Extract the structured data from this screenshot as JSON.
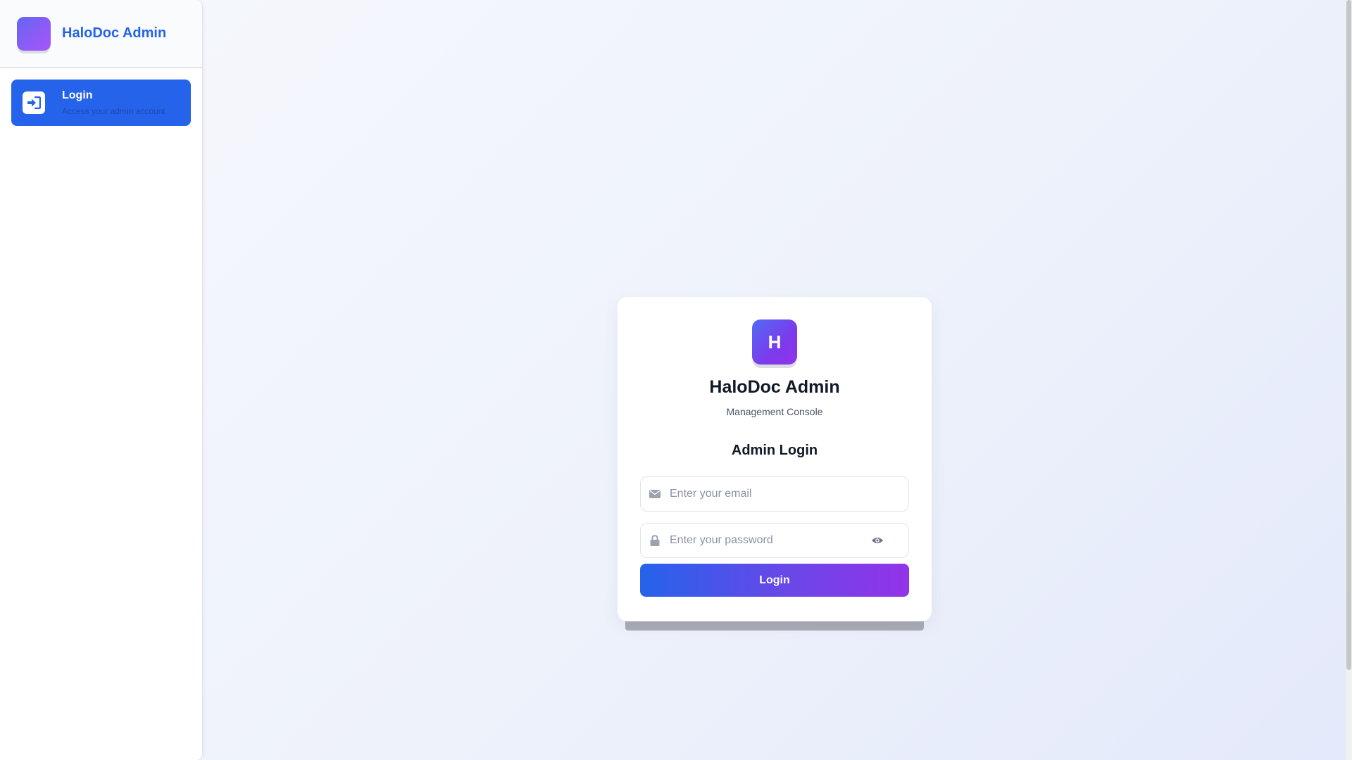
{
  "sidebar": {
    "brand_title": "HaloDoc Admin",
    "items": [
      {
        "label": "Login",
        "subtitle": "Access your admin account",
        "icon": "sign-in-icon",
        "active": true
      }
    ]
  },
  "card": {
    "logo_letter": "H",
    "title": "HaloDoc Admin",
    "subtitle": "Management Console",
    "heading": "Admin Login",
    "email": {
      "placeholder": "Enter your email",
      "value": "",
      "icon": "envelope-icon"
    },
    "password": {
      "placeholder": "Enter your password",
      "value": "",
      "icon": "lock-icon",
      "toggle_icon": "eye-icon"
    },
    "submit_label": "Login"
  },
  "colors": {
    "primary": "#2563eb",
    "accent_purple": "#9333ea",
    "muted_text": "#4b5563"
  }
}
